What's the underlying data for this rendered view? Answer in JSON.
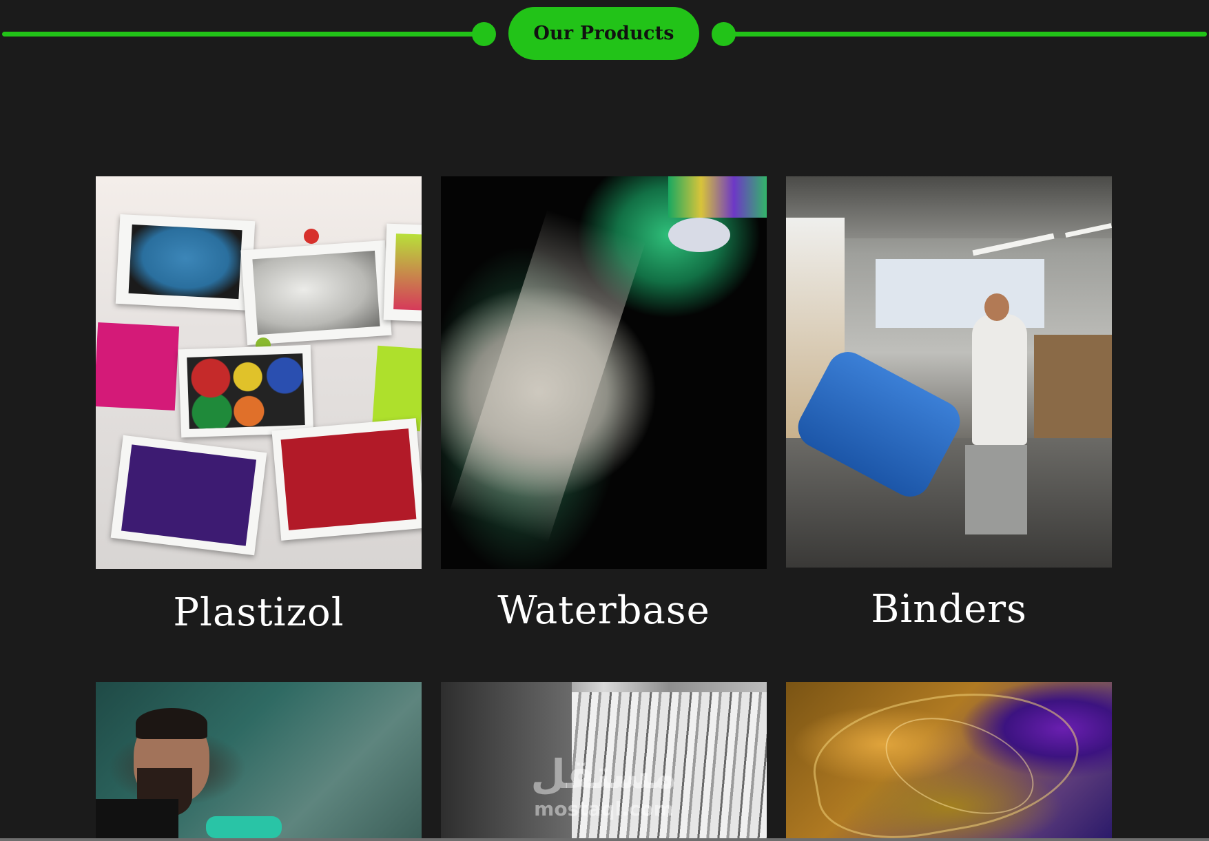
{
  "section": {
    "title": "Our Products",
    "accent_color": "#22c318",
    "background_color": "#1b1b1b"
  },
  "products": [
    {
      "name": "Plastizol",
      "image_icon": "plastizol-photo"
    },
    {
      "name": "Waterbase",
      "image_icon": "waterbase-photo"
    },
    {
      "name": "Binders",
      "image_icon": "binders-photo"
    },
    {
      "name": "",
      "image_icon": "worker-photo"
    },
    {
      "name": "",
      "image_icon": "printing-press-photo"
    },
    {
      "name": "",
      "image_icon": "ink-swirl-photo"
    }
  ],
  "watermark": {
    "arabic": "مستقل",
    "latin": "mostaql.com"
  }
}
